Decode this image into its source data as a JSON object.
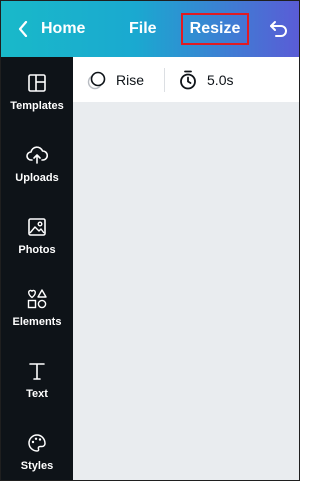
{
  "header": {
    "home_label": "Home",
    "file_label": "File",
    "resize_label": "Resize",
    "back_icon": "chevron-left-icon",
    "undo_icon": "undo-icon",
    "highlight_color": "#e01b22"
  },
  "sidebar": {
    "items": [
      {
        "label": "Templates",
        "icon": "templates-icon"
      },
      {
        "label": "Uploads",
        "icon": "cloud-upload-icon"
      },
      {
        "label": "Photos",
        "icon": "image-icon"
      },
      {
        "label": "Elements",
        "icon": "shapes-icon"
      },
      {
        "label": "Text",
        "icon": "text-icon"
      },
      {
        "label": "Styles",
        "icon": "palette-icon"
      }
    ]
  },
  "toolbar": {
    "animation_label": "Rise",
    "duration_label": "5.0s"
  }
}
